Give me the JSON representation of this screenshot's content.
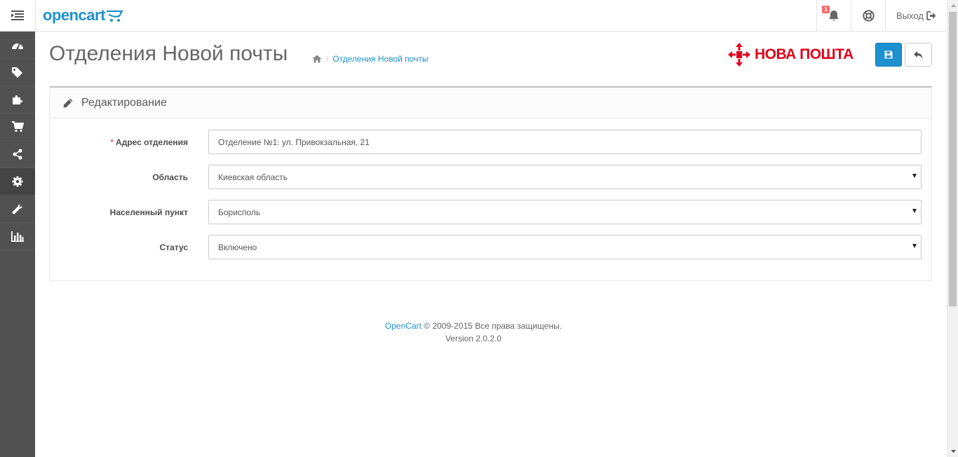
{
  "header": {
    "logo_text": "opencart",
    "notification_count": "1",
    "logout_label": "Выход"
  },
  "sidebar": {
    "items": [
      {
        "icon": "dashboard-icon"
      },
      {
        "icon": "tags-icon"
      },
      {
        "icon": "puzzle-icon"
      },
      {
        "icon": "shopping-cart-icon"
      },
      {
        "icon": "share-icon"
      },
      {
        "icon": "gear-icon",
        "active": true
      },
      {
        "icon": "wrench-icon"
      },
      {
        "icon": "bar-chart-icon"
      }
    ]
  },
  "page": {
    "title": "Отделения Новой почты",
    "breadcrumb": [
      "Отделения Новой почты"
    ],
    "brand_logo_text": "НОВА ПОШТА"
  },
  "panel": {
    "title": "Редактирование"
  },
  "form": {
    "address": {
      "label": "Адрес отделения",
      "required": true,
      "value": "Отделение №1: ул. Привокзальная, 21"
    },
    "region": {
      "label": "Область",
      "value": "Киевская область"
    },
    "city": {
      "label": "Населенный пункт",
      "value": "Борисполь"
    },
    "status": {
      "label": "Статус",
      "value": "Включено"
    }
  },
  "footer": {
    "link": "OpenCart",
    "copyright": "© 2009-2015 Все права защищены.",
    "version": "Version 2.0.2.0"
  },
  "colors": {
    "brand_blue": "#1e91cf",
    "sidebar": "#515151",
    "nova_red": "#e2001a"
  }
}
